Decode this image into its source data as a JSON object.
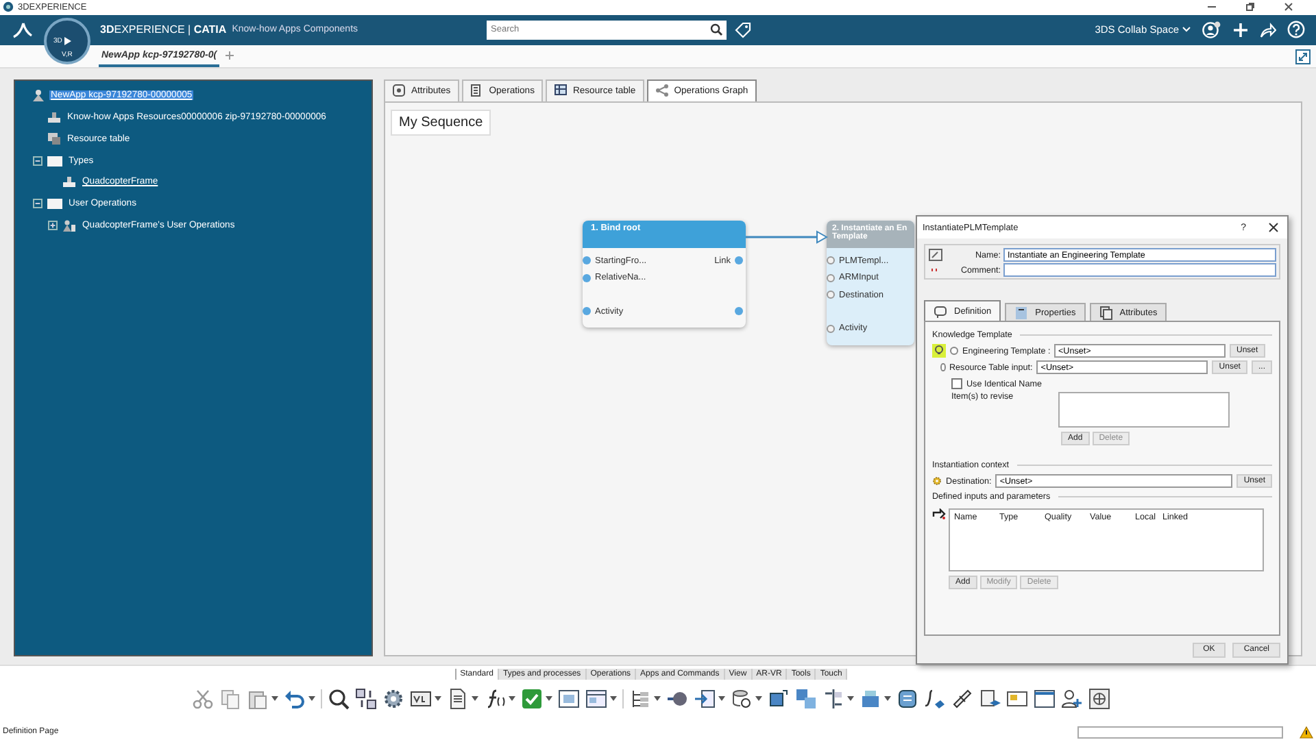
{
  "window": {
    "title": "3DEXPERIENCE"
  },
  "app_bar": {
    "brand": "**3D**EXPERIENCE | **CATIA**",
    "context": "Know-how Apps Components",
    "search": {
      "placeholder": "Search"
    },
    "space": "3DS Collab Space",
    "compass": {
      "top": "3D",
      "bottom": "V,R"
    }
  },
  "doc_tabs": [
    {
      "label": "NewApp kcp-97192780-0(",
      "selected": true
    }
  ],
  "tree": [
    {
      "label": "NewApp kcp-97192780-00000005",
      "kind": "app",
      "selected": true,
      "children": [
        {
          "label": "Know-how Apps Resources00000006 zip-97192780-00000006",
          "kind": "resource",
          "selected": false
        },
        {
          "label": "Resource table",
          "kind": "table",
          "selected": false
        },
        {
          "label": "Types",
          "kind": "folder",
          "selected": false,
          "expanded": true,
          "children": [
            {
              "label": "QuadcopterFrame",
              "kind": "type",
              "selected": false
            }
          ]
        },
        {
          "label": "User Operations",
          "kind": "folder",
          "selected": false,
          "expanded": true,
          "children": [
            {
              "label": "QuadcopterFrame's User Operations",
              "kind": "operations",
              "selected": false,
              "expanded": false
            }
          ]
        }
      ]
    }
  ],
  "view_tabs": [
    {
      "label": "Attributes",
      "selected": false
    },
    {
      "label": "Operations",
      "selected": false
    },
    {
      "label": "Resource table",
      "selected": false
    },
    {
      "label": "Operations Graph",
      "selected": true
    }
  ],
  "canvas": {
    "title": "My Sequence",
    "nodes": [
      {
        "title": "1. Bind root",
        "selected": false,
        "rows": [
          {
            "kind": "port",
            "left": "StartingFro...",
            "right": "Link",
            "left_port": true,
            "right_port": true
          },
          {
            "kind": "port",
            "left": "RelativeNa...",
            "left_port": true,
            "right_port": false
          },
          {
            "kind": "gap"
          },
          {
            "kind": "port",
            "left": "Activity",
            "left_port": true,
            "right_port": true
          }
        ]
      },
      {
        "title": "2. Instantiate an En\nTemplate",
        "selected": true,
        "rows": [
          {
            "kind": "port",
            "left": "PLMTempl...",
            "left_port": true,
            "right_port": false
          },
          {
            "kind": "port",
            "left": "ARMInput",
            "left_port": true,
            "right_port": false
          },
          {
            "kind": "port",
            "left": "Destination",
            "left_port": true,
            "right_port": false
          },
          {
            "kind": "gap"
          },
          {
            "kind": "port",
            "left": "Activity",
            "left_port": true,
            "right_port": false
          }
        ]
      }
    ]
  },
  "dialog": {
    "title": "InstantiatePLMTemplate",
    "help": "?",
    "name_label": "Name:",
    "name_value": "Instantiate an Engineering Template",
    "comment_label": "Comment:",
    "tabs": [
      {
        "label": "Definition",
        "selected": true
      },
      {
        "label": "Properties",
        "selected": false
      },
      {
        "label": "Attributes",
        "selected": false
      }
    ],
    "knowledge_template": {
      "heading": "Knowledge Template",
      "options": [
        {
          "label": "Engineering Template :",
          "value": "<Unset>",
          "button": "Unset",
          "selected": false
        },
        {
          "label": "Resource Table input:",
          "value": "<Unset>",
          "button": "Unset",
          "more": "...",
          "selected": false
        }
      ],
      "identical_name": {
        "label": "Use Identical Name",
        "checked": false
      },
      "revise_label": "Item(s) to revise",
      "buttons": [
        {
          "label": "Add",
          "disabled": false
        },
        {
          "label": "Delete",
          "disabled": true
        }
      ]
    },
    "instantiation": {
      "heading": "Instantiation context",
      "label": "Destination:",
      "value": "<Unset>",
      "button": "Unset"
    },
    "parameters": {
      "heading": "Defined inputs and parameters",
      "columns": [
        "Name",
        "Type",
        "Quality",
        "Value",
        "Local",
        "Linked"
      ],
      "buttons": [
        {
          "label": "Add",
          "disabled": false
        },
        {
          "label": "Modify",
          "disabled": true
        },
        {
          "label": "Delete",
          "disabled": true
        }
      ]
    },
    "footer": [
      "OK",
      "Cancel"
    ]
  },
  "toolbar": {
    "tabs": [
      {
        "label": "Standard",
        "selected": true
      },
      {
        "label": "Types and processes",
        "selected": false
      },
      {
        "label": "Operations",
        "selected": false
      },
      {
        "label": "Apps and Commands",
        "selected": false
      },
      {
        "label": "View",
        "selected": false
      },
      {
        "label": "AR-VR",
        "selected": false
      },
      {
        "label": "Tools",
        "selected": false
      },
      {
        "label": "Touch",
        "selected": false
      }
    ]
  },
  "status_bar": {
    "text": "Definition Page"
  }
}
